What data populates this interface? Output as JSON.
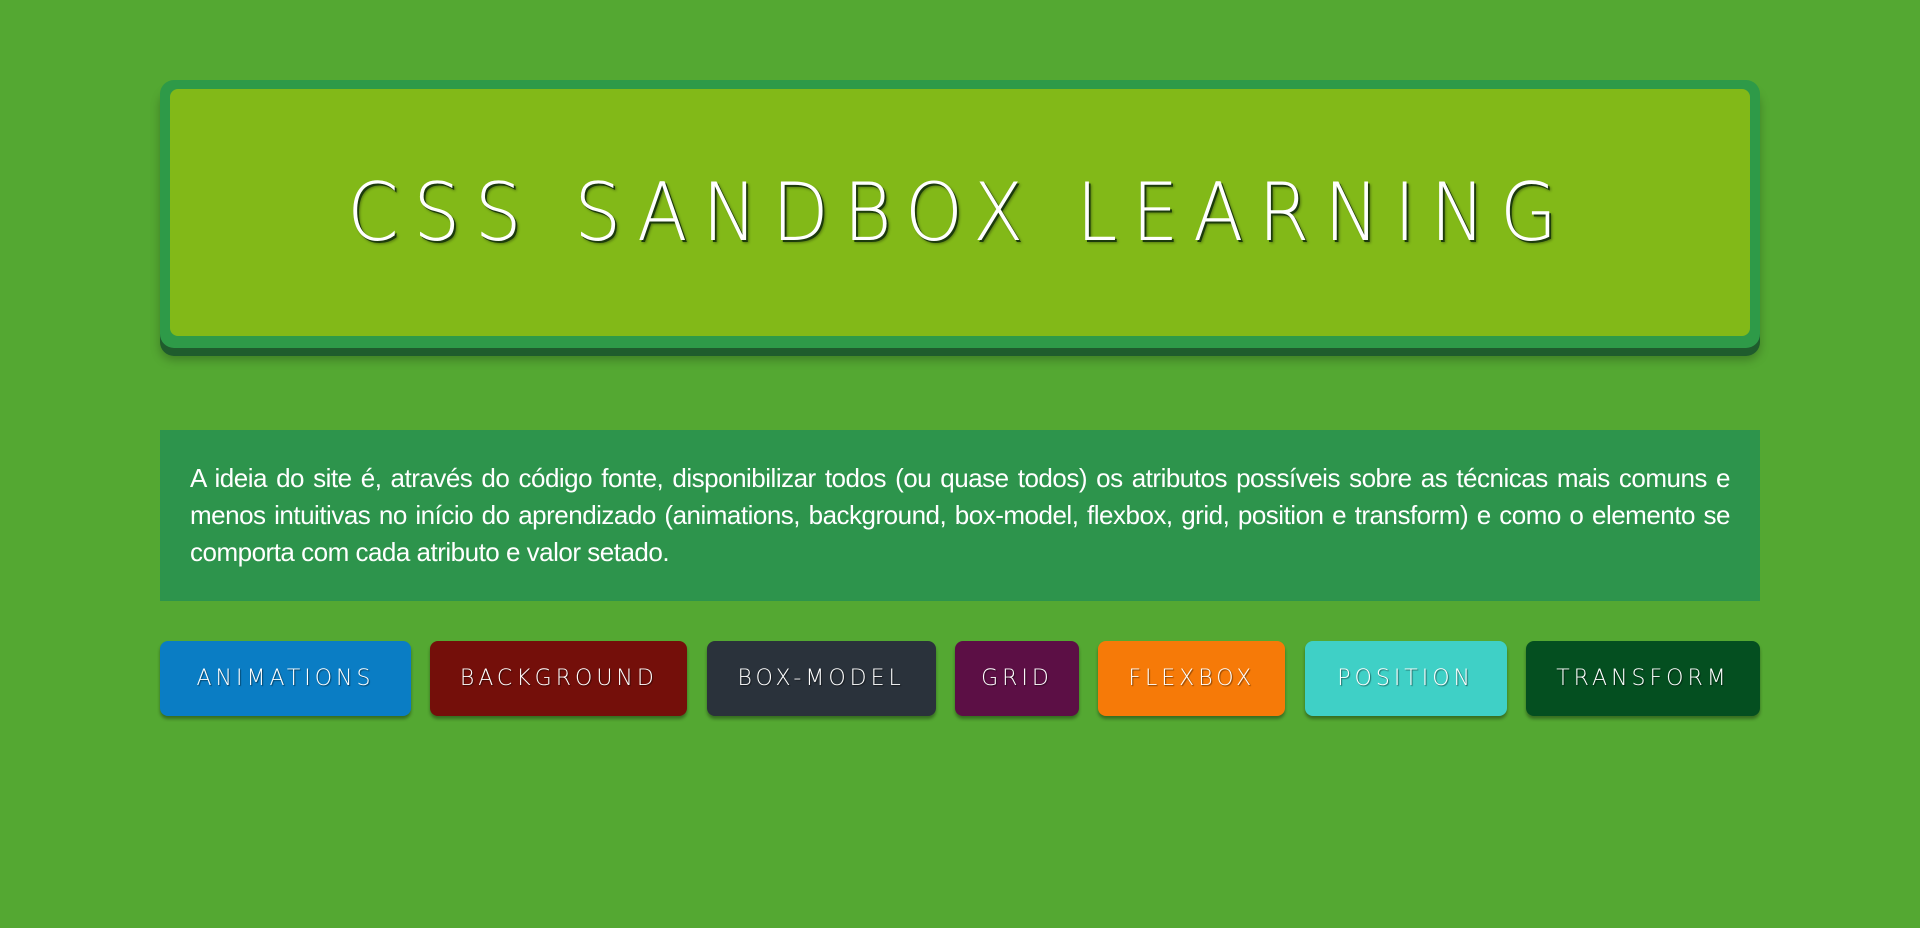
{
  "header": {
    "title": "CSS SANDBOX LEARNING"
  },
  "intro": {
    "text": "A ideia do site é, através do código fonte, disponibilizar todos (ou quase todos) os atributos possíveis sobre as técnicas mais comuns e menos intuitivas no início do aprendizado (animations, background, box-model, flexbox, grid, position e transform) e como o elemento se comporta com cada atributo e valor setado."
  },
  "nav": {
    "buttons": [
      {
        "label": "ANIMATIONS",
        "color": "#0a7dc4"
      },
      {
        "label": "BACKGROUND",
        "color": "#740f0a"
      },
      {
        "label": "BOX-MODEL",
        "color": "#2a323b"
      },
      {
        "label": "GRID",
        "color": "#5c0f45"
      },
      {
        "label": "FLEXBOX",
        "color": "#f67a08"
      },
      {
        "label": "POSITION",
        "color": "#3fd0c6"
      },
      {
        "label": "TRANSFORM",
        "color": "#044f20"
      }
    ]
  },
  "colors": {
    "page_background": "#54a832",
    "hero_frame": "#2e9a48",
    "hero_panel": "#82b918",
    "intro_panel": "#2d944c"
  }
}
